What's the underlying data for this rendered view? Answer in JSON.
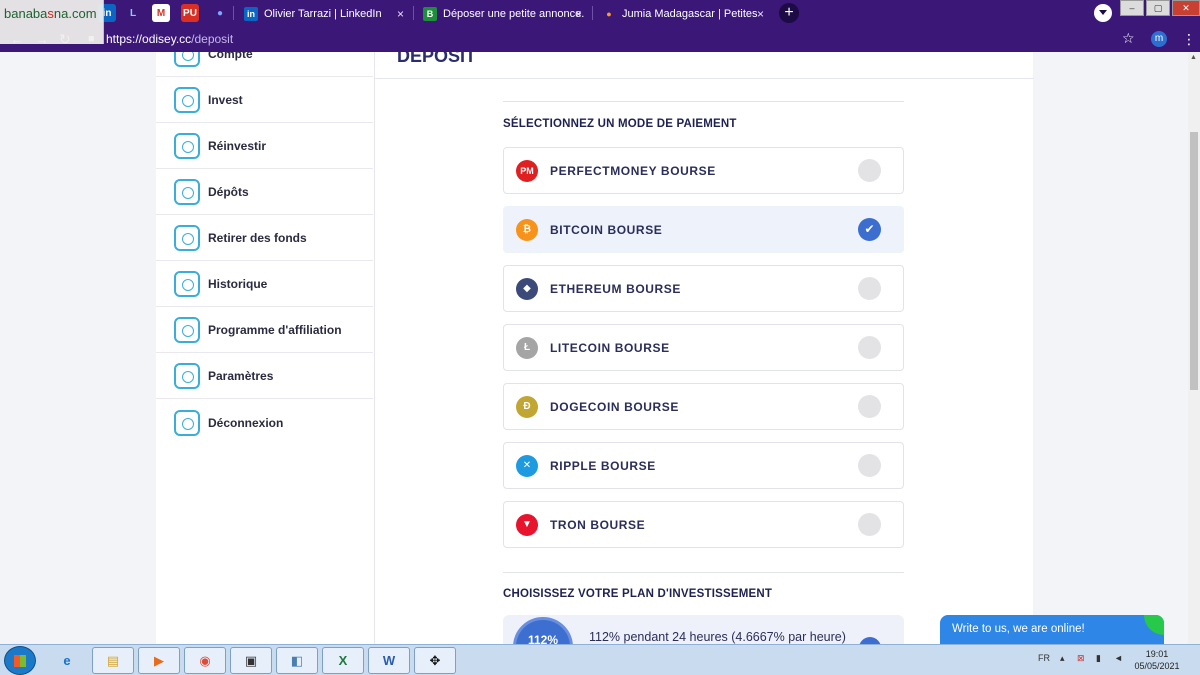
{
  "browser": {
    "tabs": [
      {
        "label": "Olivier Tarrazi | LinkedIn",
        "favicon": "linkedin-icon"
      },
      {
        "label": "Déposer une petite annonce.",
        "favicon": "b-icon"
      },
      {
        "label": "Jumia Madagascar | Petites annon",
        "favicon": "jumia-icon"
      }
    ],
    "pinned_favicons": [
      "linkedin-icon",
      "ms-icon",
      "gmail-icon",
      "pu-icon",
      "chrome-icon"
    ],
    "url_host": "https://odisey.cc",
    "url_path": "/deposit",
    "profile_initial": "m",
    "close_glyph": "×",
    "new_tab_glyph": "+"
  },
  "logo_overlay": {
    "text_a": "banaba",
    "text_b": "s",
    "text_c": "na.com"
  },
  "sidebar": {
    "items": [
      {
        "label": "Compte",
        "icon": "account-icon"
      },
      {
        "label": "Invest",
        "icon": "invest-icon"
      },
      {
        "label": "Réinvestir",
        "icon": "reinvest-icon"
      },
      {
        "label": "Dépôts",
        "icon": "deposits-icon"
      },
      {
        "label": "Retirer des fonds",
        "icon": "withdraw-icon"
      },
      {
        "label": "Historique",
        "icon": "history-icon"
      },
      {
        "label": "Programme d'affiliation",
        "icon": "affiliate-icon"
      },
      {
        "label": "Paramètres",
        "icon": "settings-icon"
      },
      {
        "label": "Déconnexion",
        "icon": "logout-icon"
      }
    ]
  },
  "main": {
    "title": "DEPOSIT",
    "payment_title": "SÉLECTIONNEZ UN MODE DE PAIEMENT",
    "payment_methods": [
      {
        "name": "PERFECTMONEY BOURSE",
        "coin": "PM",
        "color": "#e02020",
        "selected": false
      },
      {
        "name": "BITCOIN BOURSE",
        "coin": "₿",
        "color": "#f7931a",
        "selected": true
      },
      {
        "name": "ETHEREUM BOURSE",
        "coin": "◆",
        "color": "#3c4a7a",
        "selected": false
      },
      {
        "name": "LITECOIN BOURSE",
        "coin": "Ł",
        "color": "#a5a5a5",
        "selected": false
      },
      {
        "name": "DOGECOIN BOURSE",
        "coin": "Ð",
        "color": "#c2a633",
        "selected": false
      },
      {
        "name": "RIPPLE BOURSE",
        "coin": "✕",
        "color": "#1e9be0",
        "selected": false
      },
      {
        "name": "TRON BOURSE",
        "coin": "▼",
        "color": "#e8132c",
        "selected": false
      }
    ],
    "selected_check": "✔",
    "plan_title": "CHOISISSEZ VOTRE PLAN D'INVESTISSEMENT",
    "plan": {
      "badge": "112%",
      "text": "112% pendant 24 heures (4.6667% par heure)"
    }
  },
  "chat_widget": {
    "text": "Write to us, we are online!"
  },
  "taskbar": {
    "lang": "FR",
    "time": "19:01",
    "date": "05/05/2021"
  }
}
